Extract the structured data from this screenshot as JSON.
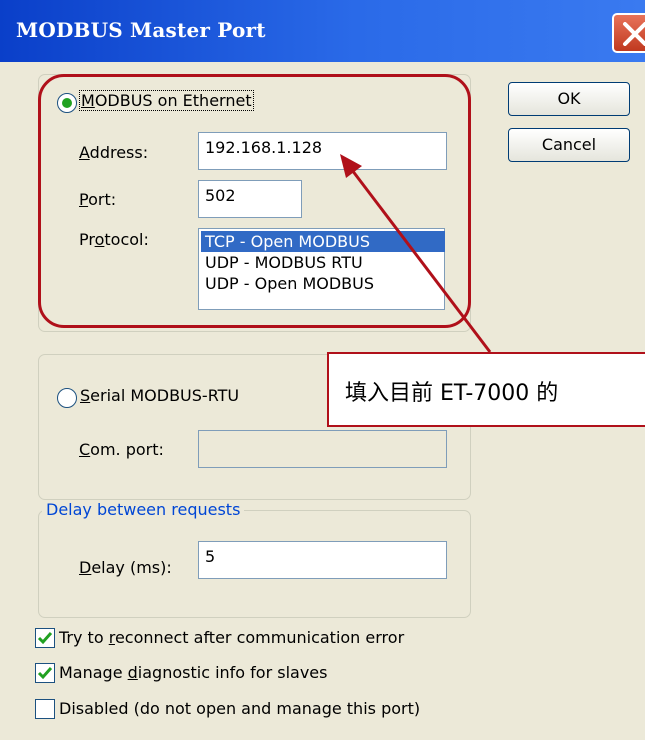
{
  "window": {
    "title": "MODBUS Master Port"
  },
  "ethernet": {
    "option_pre": "",
    "option_ul": "M",
    "option_post": "ODBUS on Ethernet",
    "address_ul": "A",
    "address_post": "ddress:",
    "address_value": "192.168.1.128",
    "port_ul": "P",
    "port_post": "ort:",
    "port_value": "502",
    "protocol_pre": "Pr",
    "protocol_ul": "o",
    "protocol_post": "tocol:",
    "protocols": [
      "TCP - Open MODBUS",
      "UDP - MODBUS RTU",
      "UDP - Open MODBUS"
    ],
    "selected_protocol": "TCP - Open MODBUS"
  },
  "serial": {
    "option_ul": "S",
    "option_post": "erial MODBUS-RTU",
    "com_ul": "C",
    "com_post": "om. port:",
    "com_value": ""
  },
  "delay": {
    "group_label": "Delay between requests",
    "label_ul": "D",
    "label_post": "elay (ms):",
    "value": "5"
  },
  "options": {
    "reconnect_pre": "Try to ",
    "reconnect_ul": "r",
    "reconnect_post": "econnect after communication error",
    "reconnect_checked": true,
    "diag_pre": "Manage ",
    "diag_ul": "d",
    "diag_post": "iagnostic info for slaves",
    "diag_checked": true,
    "disabled_label": "Disabled (do not open and manage this port)",
    "disabled_checked": false
  },
  "buttons": {
    "ok": "OK",
    "cancel": "Cancel"
  },
  "annotation": {
    "callout_text": "填入目前  ET-7000  的",
    "color": "#b0101a"
  }
}
